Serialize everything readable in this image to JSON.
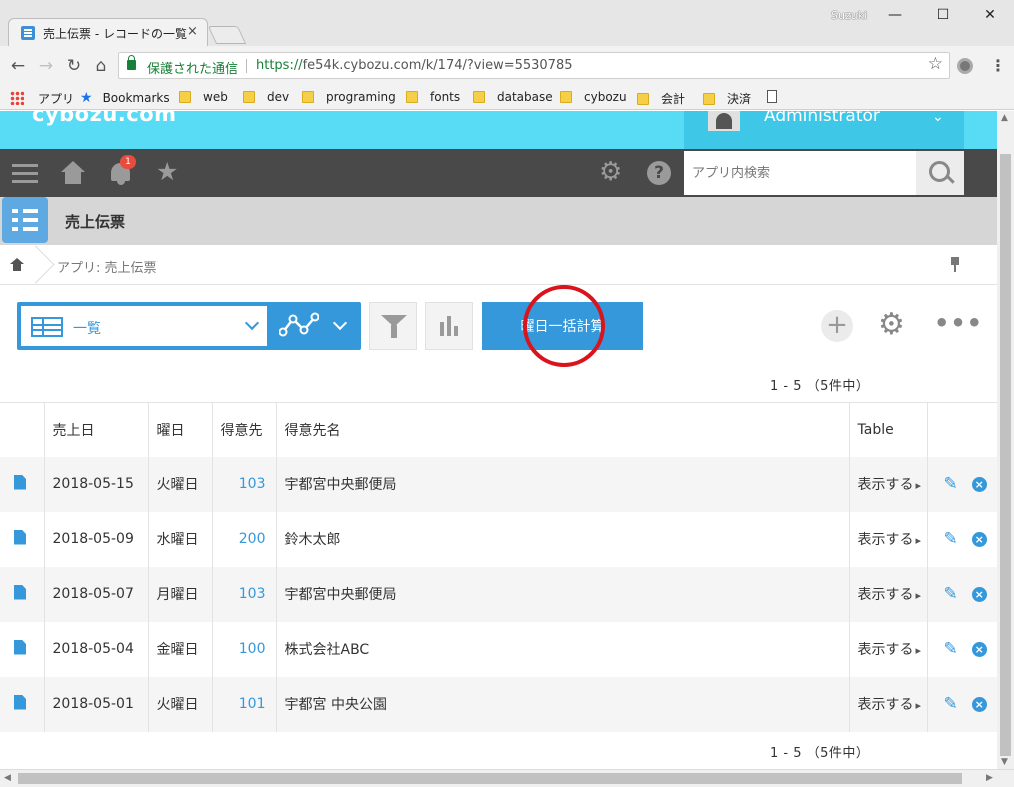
{
  "browser": {
    "tab_title": "売上伝票 - レコードの一覧",
    "tab_close": "×",
    "user": "Suzuki",
    "win_min": "—",
    "win_max": "☐",
    "win_close": "✕",
    "back": "←",
    "forward": "→",
    "reload": "↻",
    "home": "⌂",
    "secure_label": "保護された通信",
    "url_scheme": "https://",
    "url_rest": "fe54k.cybozu.com/k/174/?view=5530785",
    "bookmark_star": "☆",
    "menu": "⋮",
    "bookmarks": {
      "apps": "アプリ",
      "bookmarks": "Bookmarks",
      "folders": [
        "web",
        "dev",
        "programing",
        "fonts",
        "database",
        "cybozu",
        "会計",
        "決済"
      ]
    }
  },
  "header": {
    "logo": "cybozu.com",
    "account_name": "Administrator",
    "account_caret": "⌄"
  },
  "gnav": {
    "notification_count": "1",
    "favorite_glyph": "★",
    "gear_glyph": "⚙",
    "help_glyph": "?",
    "search_placeholder": "アプリ内検索"
  },
  "app": {
    "title": "売上伝票",
    "breadcrumb": "アプリ: 売上伝票"
  },
  "view": {
    "name": "一覧",
    "calc_button": "曜日一括計算",
    "add_glyph": "+",
    "settings_glyph": "⚙",
    "more_glyph": "•••"
  },
  "pager": {
    "text": "1 - 5 （5件中）"
  },
  "table": {
    "columns": [
      "売上日",
      "曜日",
      "得意先",
      "得意先名",
      "Table"
    ],
    "link_label": "表示する",
    "edit_glyph": "✎",
    "delete_glyph": "×",
    "rows": [
      {
        "date": "2018-05-15",
        "weekday": "火曜日",
        "customer": "103",
        "customer_name": "宇都宮中央郵便局"
      },
      {
        "date": "2018-05-09",
        "weekday": "水曜日",
        "customer": "200",
        "customer_name": "鈴木太郎"
      },
      {
        "date": "2018-05-07",
        "weekday": "月曜日",
        "customer": "103",
        "customer_name": "宇都宮中央郵便局"
      },
      {
        "date": "2018-05-04",
        "weekday": "金曜日",
        "customer": "100",
        "customer_name": "株式会社ABC"
      },
      {
        "date": "2018-05-01",
        "weekday": "火曜日",
        "customer": "101",
        "customer_name": "宇都宮 中央公園"
      }
    ]
  }
}
